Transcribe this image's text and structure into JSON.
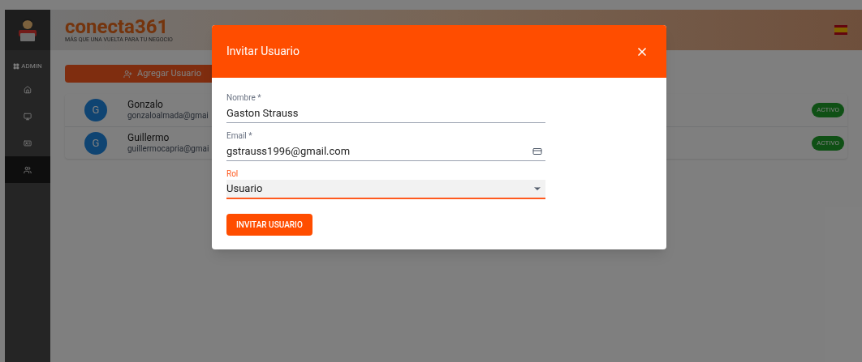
{
  "header": {
    "logo": "conecta361",
    "tagline": "MÁS QUE UNA VUELTA PARA TU NEGOCIO"
  },
  "sidebar": {
    "section": "ADMIN",
    "items": [
      {
        "kind": "home",
        "selected": false
      },
      {
        "kind": "monitor",
        "selected": false
      },
      {
        "kind": "card",
        "selected": false
      },
      {
        "kind": "users",
        "selected": true
      }
    ]
  },
  "add_button": "Agregar Usuario",
  "users": [
    {
      "initial": "G",
      "name": "Gonzalo",
      "email": "gonzaloalmada@gmai",
      "status": "ACTIVO"
    },
    {
      "initial": "G",
      "name": "Guillermo",
      "email": "guillermocapria@gmai",
      "status": "ACTIVO"
    }
  ],
  "dialog": {
    "title": "Invitar Usuario",
    "fields": [
      {
        "kind": "text",
        "label": "Nombre *",
        "value": "Gaston Strauss",
        "focused": false
      },
      {
        "kind": "email",
        "label": "Email *",
        "value": "gstrauss1996@gmail.com",
        "focused": false
      },
      {
        "kind": "select",
        "label": "Rol",
        "value": "Usuario",
        "focused": true
      }
    ],
    "submit": "INVITAR USUARIO"
  }
}
